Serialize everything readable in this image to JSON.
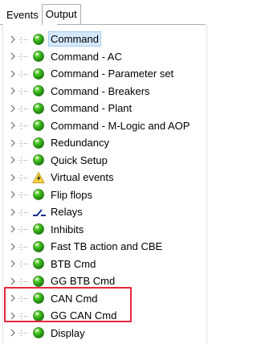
{
  "tabs": [
    {
      "label": "Events"
    },
    {
      "label": "Output"
    }
  ],
  "tree": {
    "items": [
      {
        "label": "Command",
        "icon": "green-circle-icon",
        "selected": true
      },
      {
        "label": "Command - AC",
        "icon": "green-circle-icon"
      },
      {
        "label": "Command - Parameter set",
        "icon": "green-circle-icon"
      },
      {
        "label": "Command - Breakers",
        "icon": "green-circle-icon"
      },
      {
        "label": "Command - Plant",
        "icon": "green-circle-icon"
      },
      {
        "label": "Command - M-Logic and AOP",
        "icon": "green-circle-icon"
      },
      {
        "label": "Redundancy",
        "icon": "green-circle-icon"
      },
      {
        "label": "Quick Setup",
        "icon": "green-circle-icon"
      },
      {
        "label": "Virtual events",
        "icon": "warning-triangle-icon"
      },
      {
        "label": "Flip flops",
        "icon": "green-circle-icon"
      },
      {
        "label": "Relays",
        "icon": "relay-switch-icon"
      },
      {
        "label": "Inhibits",
        "icon": "green-circle-icon"
      },
      {
        "label": "Fast TB action and CBE",
        "icon": "green-circle-icon"
      },
      {
        "label": "BTB Cmd",
        "icon": "green-circle-icon"
      },
      {
        "label": "GG BTB Cmd",
        "icon": "green-circle-icon"
      },
      {
        "label": "CAN Cmd",
        "icon": "green-circle-icon"
      },
      {
        "label": "GG CAN Cmd",
        "icon": "green-circle-icon"
      },
      {
        "label": "Display",
        "icon": "green-circle-icon"
      }
    ]
  },
  "colors": {
    "highlight": "#e8253d",
    "selection": "#d5e9fb"
  }
}
